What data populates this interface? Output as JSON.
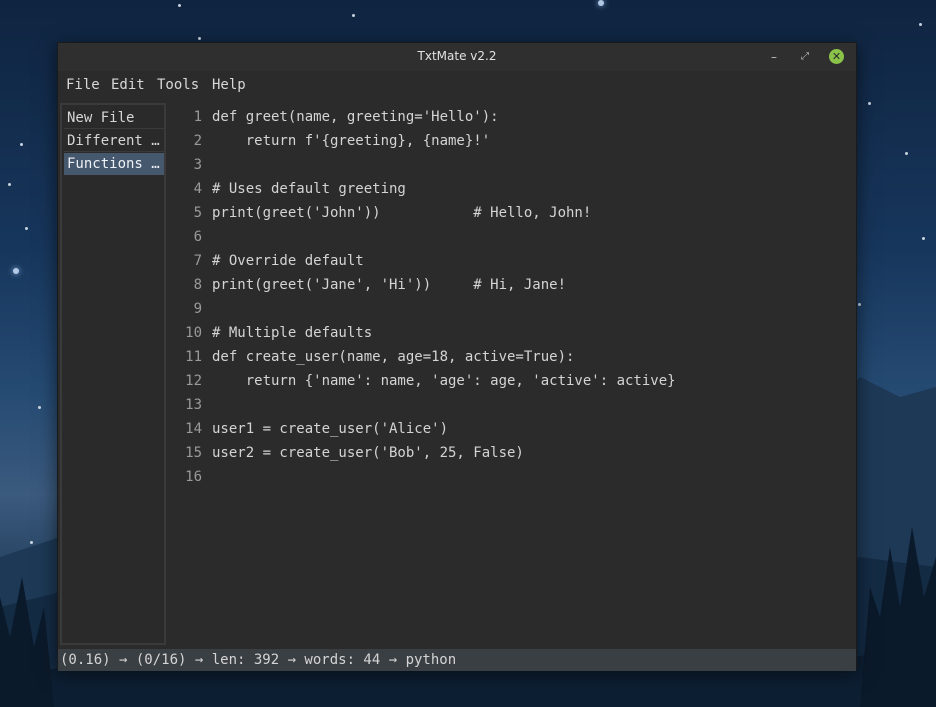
{
  "window": {
    "title": "TxtMate v2.2",
    "minimize_icon": "minimize-icon",
    "maximize_icon": "maximize-icon",
    "close_icon": "close-icon",
    "minimize_glyph": "–",
    "maximize_glyph": "⤢",
    "close_glyph": "✕",
    "close_color": "#8bc34a"
  },
  "menu": [
    "File",
    "Edit",
    "Tools",
    "Help"
  ],
  "sidebar": {
    "items": [
      {
        "label": "New File",
        "active": false
      },
      {
        "label": "Different …",
        "active": false
      },
      {
        "label": "Functions …",
        "active": true
      }
    ],
    "active_color": "#46586e"
  },
  "editor": {
    "lines": [
      {
        "n": "1",
        "text": "def greet(name, greeting='Hello'):"
      },
      {
        "n": "2",
        "text": "    return f'{greeting}, {name}!'"
      },
      {
        "n": "3",
        "text": ""
      },
      {
        "n": "4",
        "text": "# Uses default greeting"
      },
      {
        "n": "5",
        "text": "print(greet('John'))           # Hello, John!"
      },
      {
        "n": "6",
        "text": ""
      },
      {
        "n": "7",
        "text": "# Override default"
      },
      {
        "n": "8",
        "text": "print(greet('Jane', 'Hi'))     # Hi, Jane!"
      },
      {
        "n": "9",
        "text": ""
      },
      {
        "n": "10",
        "text": "# Multiple defaults"
      },
      {
        "n": "11",
        "text": "def create_user(name, age=18, active=True):"
      },
      {
        "n": "12",
        "text": "    return {'name': name, 'age': age, 'active': active}"
      },
      {
        "n": "13",
        "text": ""
      },
      {
        "n": "14",
        "text": "user1 = create_user('Alice')"
      },
      {
        "n": "15",
        "text": "user2 = create_user('Bob', 25, False)"
      },
      {
        "n": "16",
        "text": ""
      }
    ]
  },
  "status": {
    "text": "(0.16) → (0/16) → len: 392 → words: 44 → python"
  }
}
